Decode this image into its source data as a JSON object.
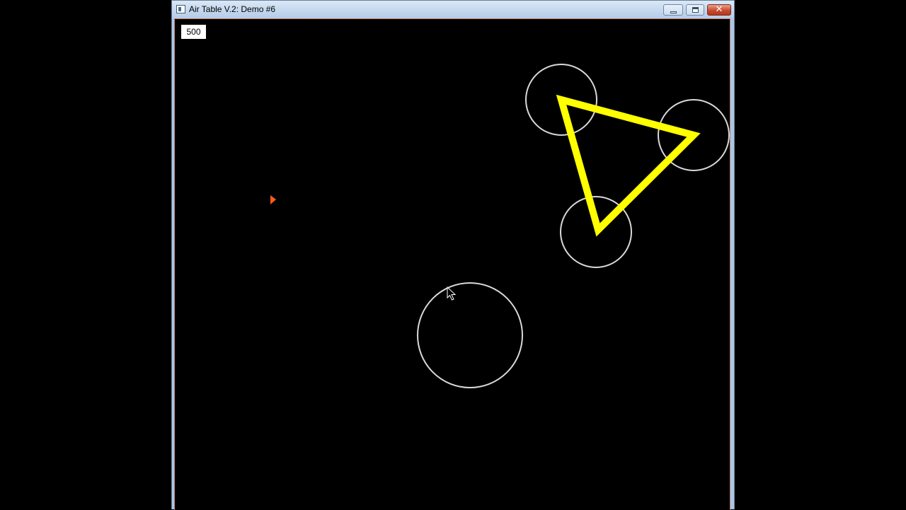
{
  "window": {
    "title": "Air Table V.2: Demo #6",
    "icon": "app-window-icon",
    "controls": {
      "minimize_icon": "minimize-icon",
      "maximize_icon": "maximize-icon",
      "close_glyph": "✕"
    }
  },
  "scene": {
    "score": "500",
    "background_color": "#000000",
    "circle_color": "#d9d9d9",
    "triangle_color": "#ffff00",
    "marker_color": "#ff5a1f",
    "cursor_icon": "mouse-pointer-icon"
  }
}
